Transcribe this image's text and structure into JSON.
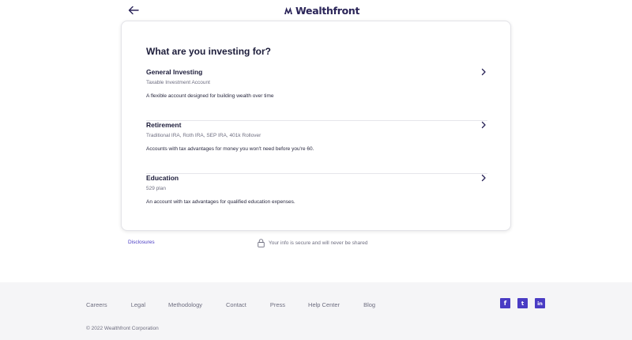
{
  "header": {
    "brand": "Wealthfront"
  },
  "card": {
    "title": "What are you investing for?",
    "options": [
      {
        "title": "General Investing",
        "subtitle": "Taxable Investment Account",
        "description": "A flexible account designed for building wealth over time"
      },
      {
        "title": "Retirement",
        "subtitle": "Traditional IRA, Roth IRA, SEP IRA, 401k Rollover",
        "description": "Accounts with tax advantages for money you won't need before you're 60."
      },
      {
        "title": "Education",
        "subtitle": "529 plan",
        "description": "An account with tax advantages for qualified education expenses."
      }
    ]
  },
  "below": {
    "disclosures": "Disclosures",
    "secure": "Your info is secure and will never be shared"
  },
  "footer": {
    "links": [
      "Careers",
      "Legal",
      "Methodology",
      "Contact",
      "Press",
      "Help Center",
      "Blog"
    ],
    "social": {
      "facebook": "f",
      "twitter": "t",
      "linkedin": "in"
    },
    "copyright": "© 2022 Wealthfront Corporation"
  },
  "colors": {
    "brand": "#2a2458",
    "accent": "#4a3cc4",
    "footer_bg": "#f5f5f7"
  }
}
